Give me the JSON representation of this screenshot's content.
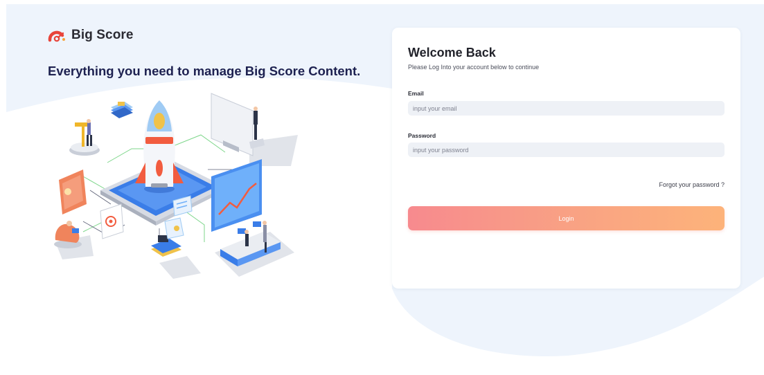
{
  "brand": {
    "name": "Big Score",
    "logo_icon": "speedometer-logo-icon",
    "tagline": "Everything you need to manage Big Score Content."
  },
  "illustration": {
    "icon": "rocket-launch-illustration"
  },
  "login": {
    "title": "Welcome Back",
    "subtitle": "Please Log Into your account below to continue",
    "email": {
      "label": "Email",
      "placeholder": "input your email",
      "value": ""
    },
    "password": {
      "label": "Password",
      "placeholder": "input your password",
      "value": ""
    },
    "forgot_label": "Forgot your password ?",
    "submit_label": "Login"
  },
  "colors": {
    "background_blue": "#eef4fc",
    "brand_red": "#e8443a",
    "tagline": "#1d2150",
    "button_start": "#f78a8e",
    "button_end": "#fdb37a"
  }
}
